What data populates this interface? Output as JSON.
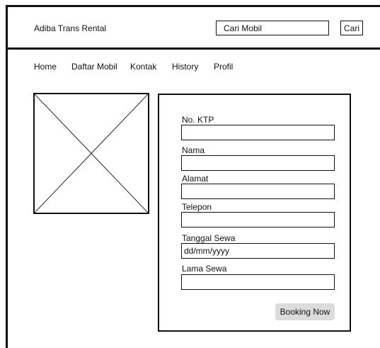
{
  "header": {
    "brand": "Adiba Trans Rental",
    "search_placeholder": "Cari Mobil",
    "search_button": "Cari"
  },
  "nav": {
    "items": [
      {
        "label": "Home"
      },
      {
        "label": "Daftar Mobil"
      },
      {
        "label": "Kontak"
      },
      {
        "label": "History"
      },
      {
        "label": "Profil"
      }
    ]
  },
  "car_image": {
    "kind": "image placeholder"
  },
  "form": {
    "fields": [
      {
        "label": "No. KTP",
        "value": "",
        "placeholder": ""
      },
      {
        "label": "Nama",
        "value": "",
        "placeholder": ""
      },
      {
        "label": "Alamat",
        "value": "",
        "placeholder": ""
      },
      {
        "label": "Telepon",
        "value": "",
        "placeholder": ""
      },
      {
        "label": "Tanggal Sewa",
        "value": "",
        "placeholder": "dd/mm/yyyy"
      },
      {
        "label": "Lama Sewa",
        "value": "",
        "placeholder": ""
      }
    ],
    "submit_label": "Booking Now",
    "submit_color": "#dcdcdc"
  }
}
